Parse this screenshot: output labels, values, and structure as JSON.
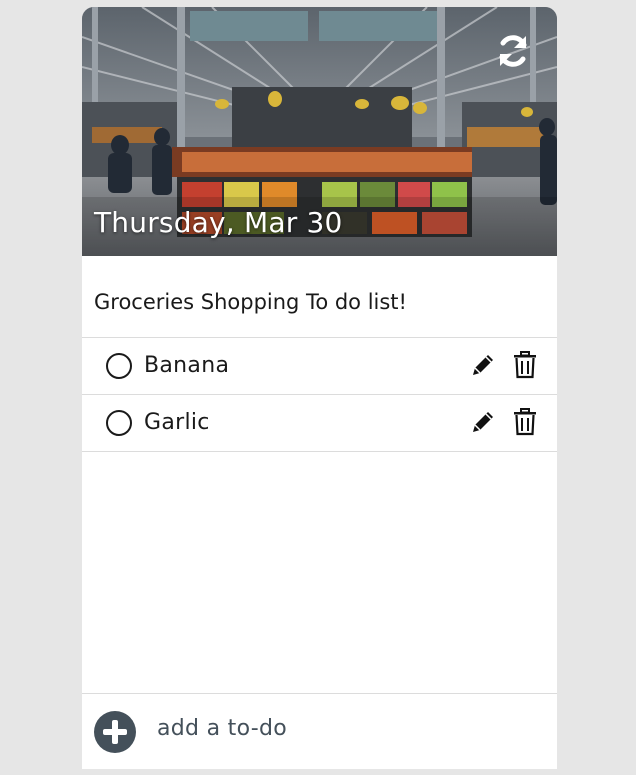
{
  "header": {
    "date": "Thursday, Mar 30",
    "image_description_icon": "market-photo",
    "refresh_icon": "refresh-icon"
  },
  "list": {
    "title": "Groceries Shopping To do list!",
    "items": [
      {
        "label": "Banana",
        "done": false
      },
      {
        "label": "Garlic",
        "done": false
      }
    ]
  },
  "footer": {
    "add_label": "add a to-do",
    "add_icon": "plus-icon"
  },
  "colors": {
    "page_background": "#e6e6e6",
    "card_background": "#ffffff",
    "text": "#1a1a1a",
    "add_button": "#44505a",
    "divider": "#dcdcdc"
  }
}
